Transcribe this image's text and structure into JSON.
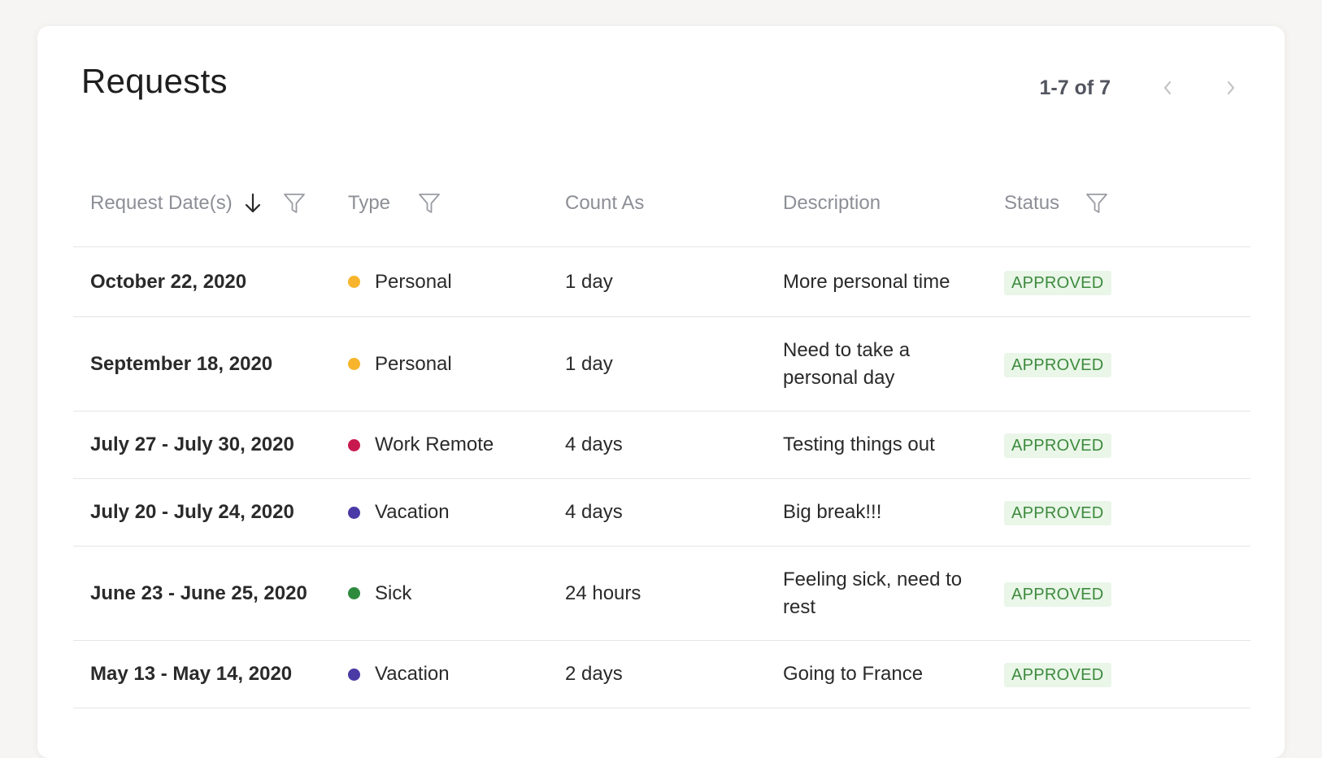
{
  "page": {
    "title": "Requests"
  },
  "pager": {
    "count": "1-7 of 7",
    "prev_icon": "chevron-left-icon",
    "next_icon": "chevron-right-icon"
  },
  "columns": [
    {
      "label": "Request Date(s)",
      "sortable": true,
      "sort_icon": "arrow-down-icon",
      "filterable": true
    },
    {
      "label": "Type",
      "filterable": true
    },
    {
      "label": "Count As"
    },
    {
      "label": "Description"
    },
    {
      "label": "Status",
      "filterable": true
    }
  ],
  "type_colors": {
    "Personal": "#f7b42c",
    "Work Remote": "#c8194f",
    "Vacation": "#4a3aa6",
    "Sick": "#2e8b3e"
  },
  "rows": [
    {
      "date": "October 22, 2020",
      "type": "Personal",
      "type_color": "#f7b42c",
      "count": "1 day",
      "description": "More personal time",
      "status": "APPROVED"
    },
    {
      "date": "September 18, 2020",
      "type": "Personal",
      "type_color": "#f7b42c",
      "count": "1 day",
      "description": "Need to take a personal day",
      "status": "APPROVED"
    },
    {
      "date": "July 27 - July 30, 2020",
      "type": "Work Remote",
      "type_color": "#c8194f",
      "count": "4 days",
      "description": "Testing things out",
      "status": "APPROVED"
    },
    {
      "date": "July 20 - July 24, 2020",
      "type": "Vacation",
      "type_color": "#4a3aa6",
      "count": "4 days",
      "description": "Big break!!!",
      "status": "APPROVED"
    },
    {
      "date": "June 23 - June 25, 2020",
      "type": "Sick",
      "type_color": "#2e8b3e",
      "count": "24 hours",
      "description": "Feeling sick, need to rest",
      "status": "APPROVED"
    },
    {
      "date": "May 13 - May 14, 2020",
      "type": "Vacation",
      "type_color": "#4a3aa6",
      "count": "2 days",
      "description": "Going to France",
      "status": "APPROVED"
    }
  ],
  "colors": {
    "approved_bg": "#e9f6e8",
    "approved_text": "#3d8a3d",
    "header_text": "#8d8f96"
  }
}
